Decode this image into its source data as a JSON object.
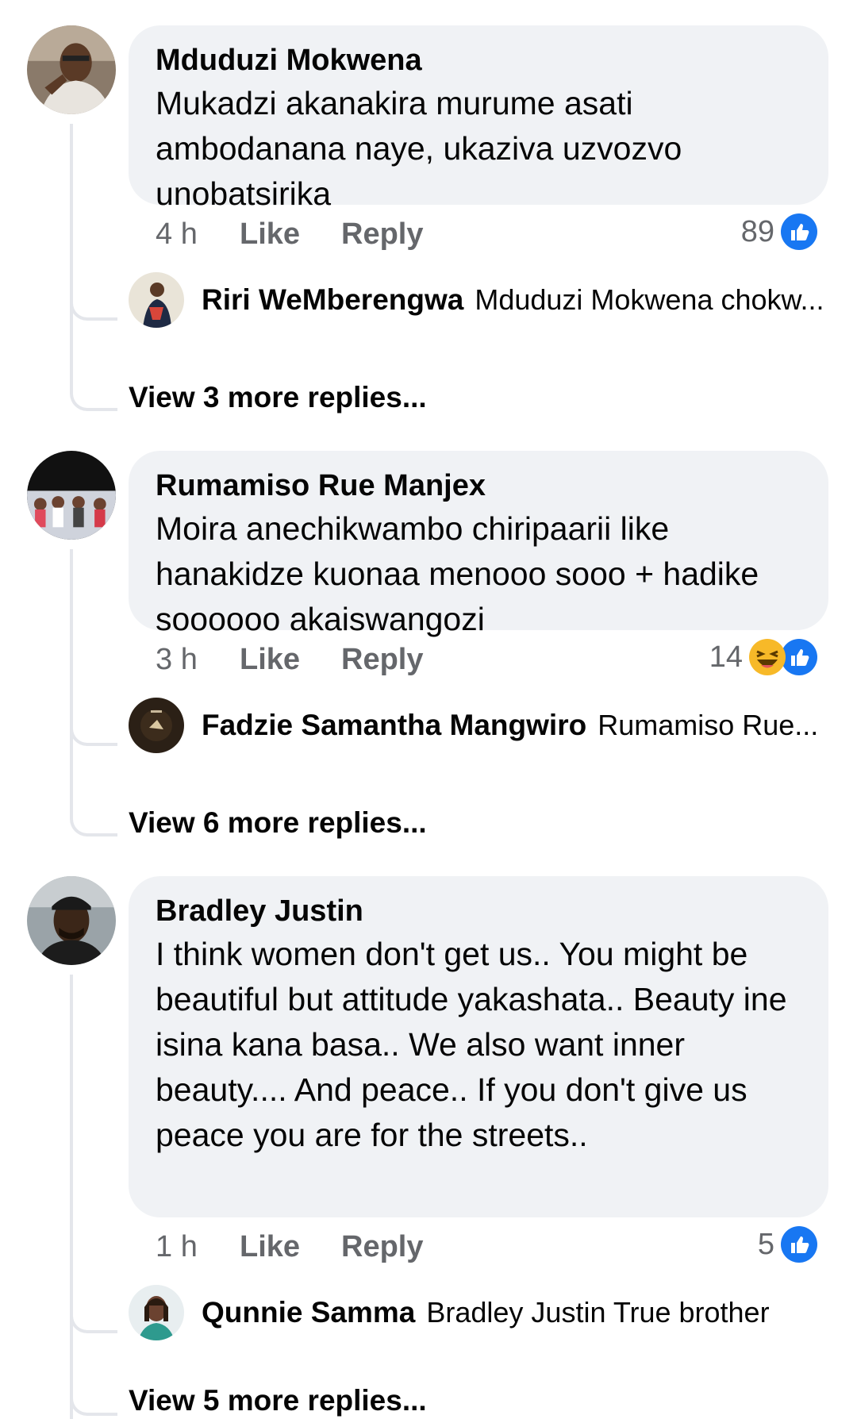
{
  "comments": [
    {
      "author": "Mduduzi Mokwena",
      "text": "Mukadzi akanakira murume asati ambodanana naye, ukaziva uzvozvo unobatsirika",
      "time": "4 h",
      "like_label": "Like",
      "reply_label": "Reply",
      "reaction_count": "89",
      "reactions": [
        "like-icon"
      ],
      "reply_preview": {
        "author": "Riri WeMberengwa",
        "text": "Mduduzi Mokwena chokw..."
      },
      "more_replies": "View 3 more replies..."
    },
    {
      "author": "Rumamiso Rue Manjex",
      "text": "Moira anechikwambo chiripaarii like hanakidze kuonaa menooo sooo + hadike soooooo akaiswangozi",
      "time": "3 h",
      "like_label": "Like",
      "reply_label": "Reply",
      "reaction_count": "14",
      "reactions": [
        "haha-icon",
        "like-icon"
      ],
      "reply_preview": {
        "author": "Fadzie Samantha Mangwiro",
        "text": "Rumamiso Rue..."
      },
      "more_replies": "View 6 more replies..."
    },
    {
      "author": "Bradley Justin",
      "text": "I think women don't get us.. You might be beautiful but attitude yakashata.. Beauty  ine isina kana basa.. We also want inner beauty.... And peace.. If you don't give us peace you are for the streets..",
      "time": "1 h",
      "like_label": "Like",
      "reply_label": "Reply",
      "reaction_count": "5",
      "reactions": [
        "like-icon"
      ],
      "reply_preview": {
        "author": "Qunnie Samma",
        "text": "Bradley Justin True brother"
      },
      "more_replies": "View 5 more replies..."
    }
  ],
  "colors": {
    "like_blue": "#1877f2",
    "bubble": "#f0f2f5",
    "meta_gray": "#65676b",
    "thread_line": "#e4e6eb",
    "haha_yellow": "#f7b928"
  }
}
